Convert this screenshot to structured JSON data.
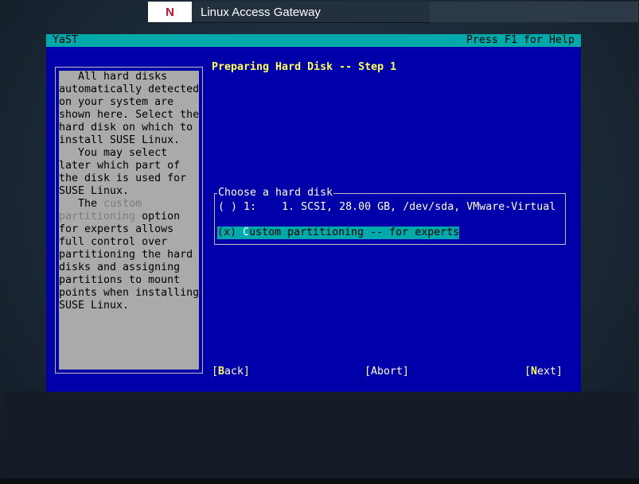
{
  "window": {
    "brand_logo_letter": "N",
    "product_name": "Linux Access Gateway"
  },
  "yast": {
    "app_name": "YaST",
    "help_hint": "Press F1 for Help",
    "step_title": "Preparing Hard Disk -- Step 1",
    "help_text": {
      "p1": "   All hard disks\nautomatically detected\non your system are\nshown here. Select the\nhard disk on which to\ninstall SUSE Linux.",
      "p2": "   You may select\nlater which part of\nthe disk is used for\nSUSE Linux.",
      "p3_pre": "   The ",
      "p3_custom": "custom",
      "p3_newline": "\n",
      "p3_partitioning": "partitioning",
      "p3_rest": " option\nfor experts allows\nfull control over\npartitioning the hard\ndisks and assigning\npartitions to mount\npoints when installing\nSUSE Linux."
    },
    "disk_selection": {
      "legend": "Choose a hard disk",
      "options": [
        {
          "radio": "( )",
          "key": "1",
          "label_rest": ":    1. SCSI, 28.00 GB, /dev/sda, VMware-Virtual",
          "selected": false
        },
        {
          "radio": "(x)",
          "key": "C",
          "label_rest": "ustom partitioning -- for experts",
          "selected": true
        }
      ]
    },
    "buttons": {
      "back": {
        "open": "[",
        "key": "B",
        "rest": "ack]"
      },
      "abort": {
        "open": "[",
        "key": "A",
        "rest": "bort]"
      },
      "next": {
        "open": "[",
        "key": "N",
        "rest": "ext]"
      }
    },
    "colors": {
      "background": "#0000aa",
      "header": "#00aaaa",
      "help_pane": "#aaaaaa",
      "title": "#ffff55",
      "hotkey": "#ffff55"
    }
  }
}
